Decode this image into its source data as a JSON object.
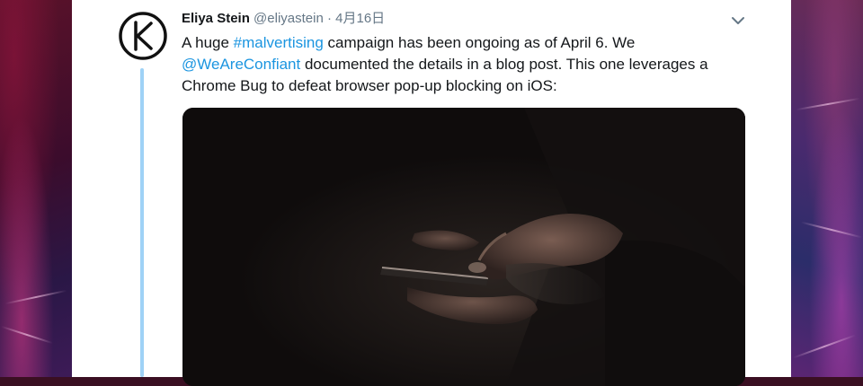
{
  "tweet": {
    "author_name": "Eliya Stein",
    "author_handle": "@eliyastein",
    "separator": " · ",
    "date": "4月16日",
    "text_part1": "A huge ",
    "hashtag": "#malvertising",
    "text_part2": " campaign has been ongoing as of April 6. We ",
    "mention": "@WeAreConfiant",
    "text_part3": " documented the details in a blog post. This one leverages a Chrome Bug to defeat browser pop-up blocking on iOS:"
  },
  "colors": {
    "link": "#1b95e0",
    "name": "#14171a",
    "secondary": "#657786",
    "thread_line": "#9fd2f6"
  },
  "icons": {
    "avatar": "k-logo-avatar",
    "menu": "chevron-down-icon"
  }
}
